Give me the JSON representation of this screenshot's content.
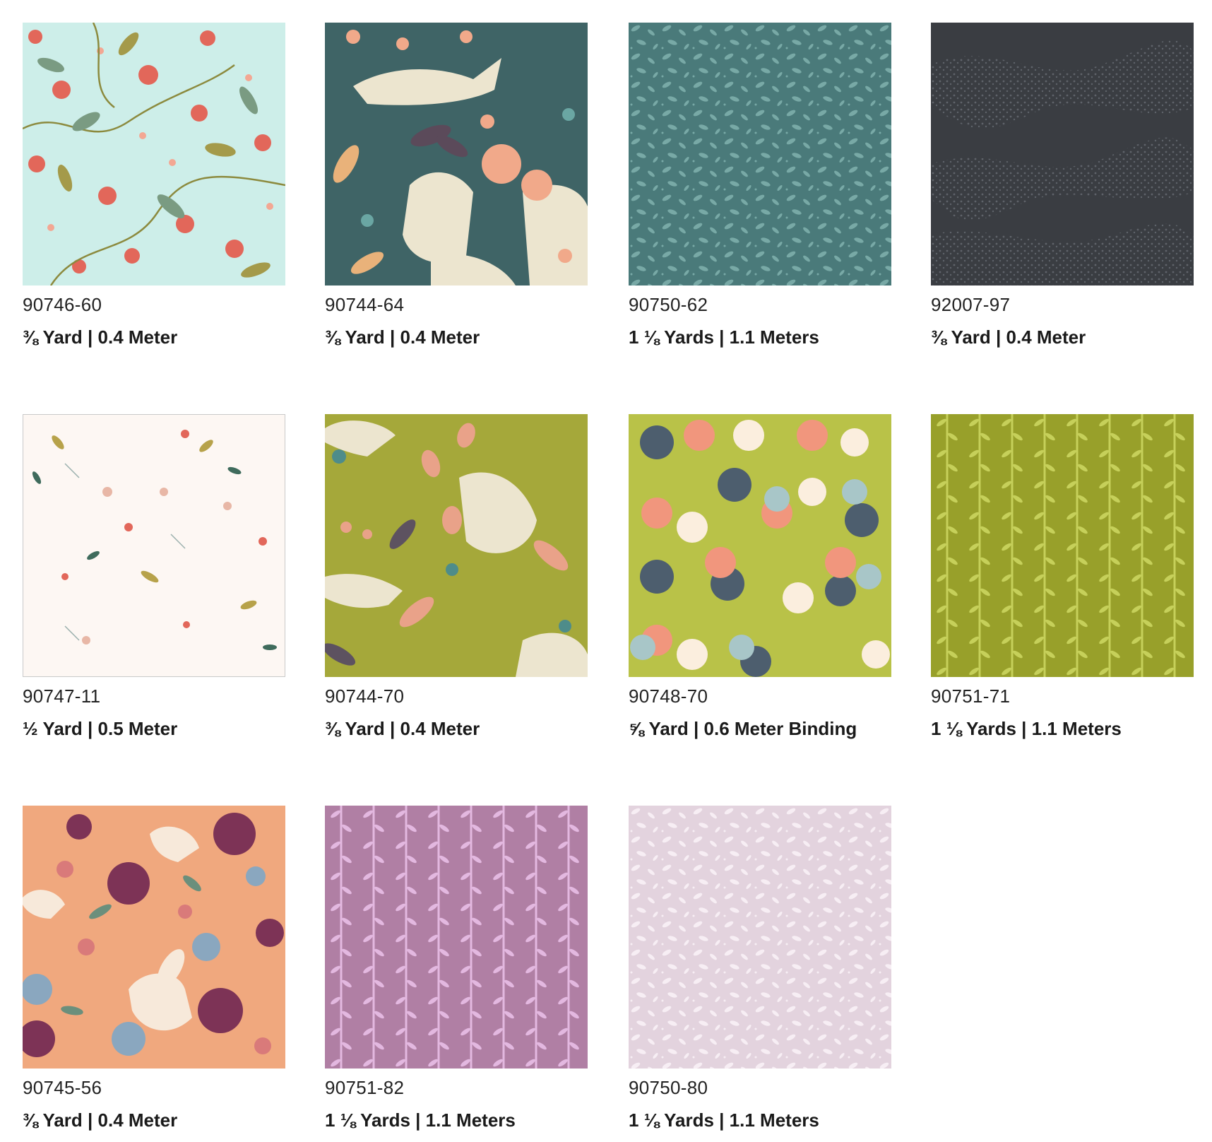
{
  "swatches": [
    {
      "code": "90746-60",
      "quantity": "⅜ Yard  |  0.4 Meter",
      "bg": "#cdeee9",
      "pattern": "strawberry-floral"
    },
    {
      "code": "90744-64",
      "quantity": "⅜ Yard  |  0.4 Meter",
      "bg": "#3f6466",
      "pattern": "fox-meadow"
    },
    {
      "code": "90750-62",
      "quantity": "1 ⅛ Yards  |  1.1 Meters",
      "bg": "#4a7a7a",
      "pattern": "leaf-scatter"
    },
    {
      "code": "92007-97",
      "quantity": "⅜ Yard  |  0.4 Meter",
      "bg": "#3a3d42",
      "pattern": "stipple-waves"
    },
    {
      "code": "90747-11",
      "quantity": "½ Yard  |  0.5 Meter",
      "bg": "#fdf7f3",
      "pattern": "tossed-sprigs"
    },
    {
      "code": "90744-70",
      "quantity": "⅜ Yard  |  0.4 Meter",
      "bg": "#a5a83a",
      "pattern": "fox-meadow"
    },
    {
      "code": "90748-70",
      "quantity": "⅝ Yard  |  0.6 Meter Binding",
      "bg": "#b9c248",
      "pattern": "dots"
    },
    {
      "code": "90751-71",
      "quantity": "1 ⅛ Yards  |  1.1 Meters",
      "bg": "#98a02a",
      "pattern": "vine-stripe"
    },
    {
      "code": "90745-56",
      "quantity": "⅜ Yard  |  0.4 Meter",
      "bg": "#f0a87e",
      "pattern": "bunny-floral"
    },
    {
      "code": "90751-82",
      "quantity": "1 ⅛ Yards  |  1.1 Meters",
      "bg": "#b07fa4",
      "pattern": "vine-stripe"
    },
    {
      "code": "90750-80",
      "quantity": "1 ⅛ Yards  |  1.1 Meters",
      "bg": "#e3d3de",
      "pattern": "leaf-scatter"
    }
  ]
}
